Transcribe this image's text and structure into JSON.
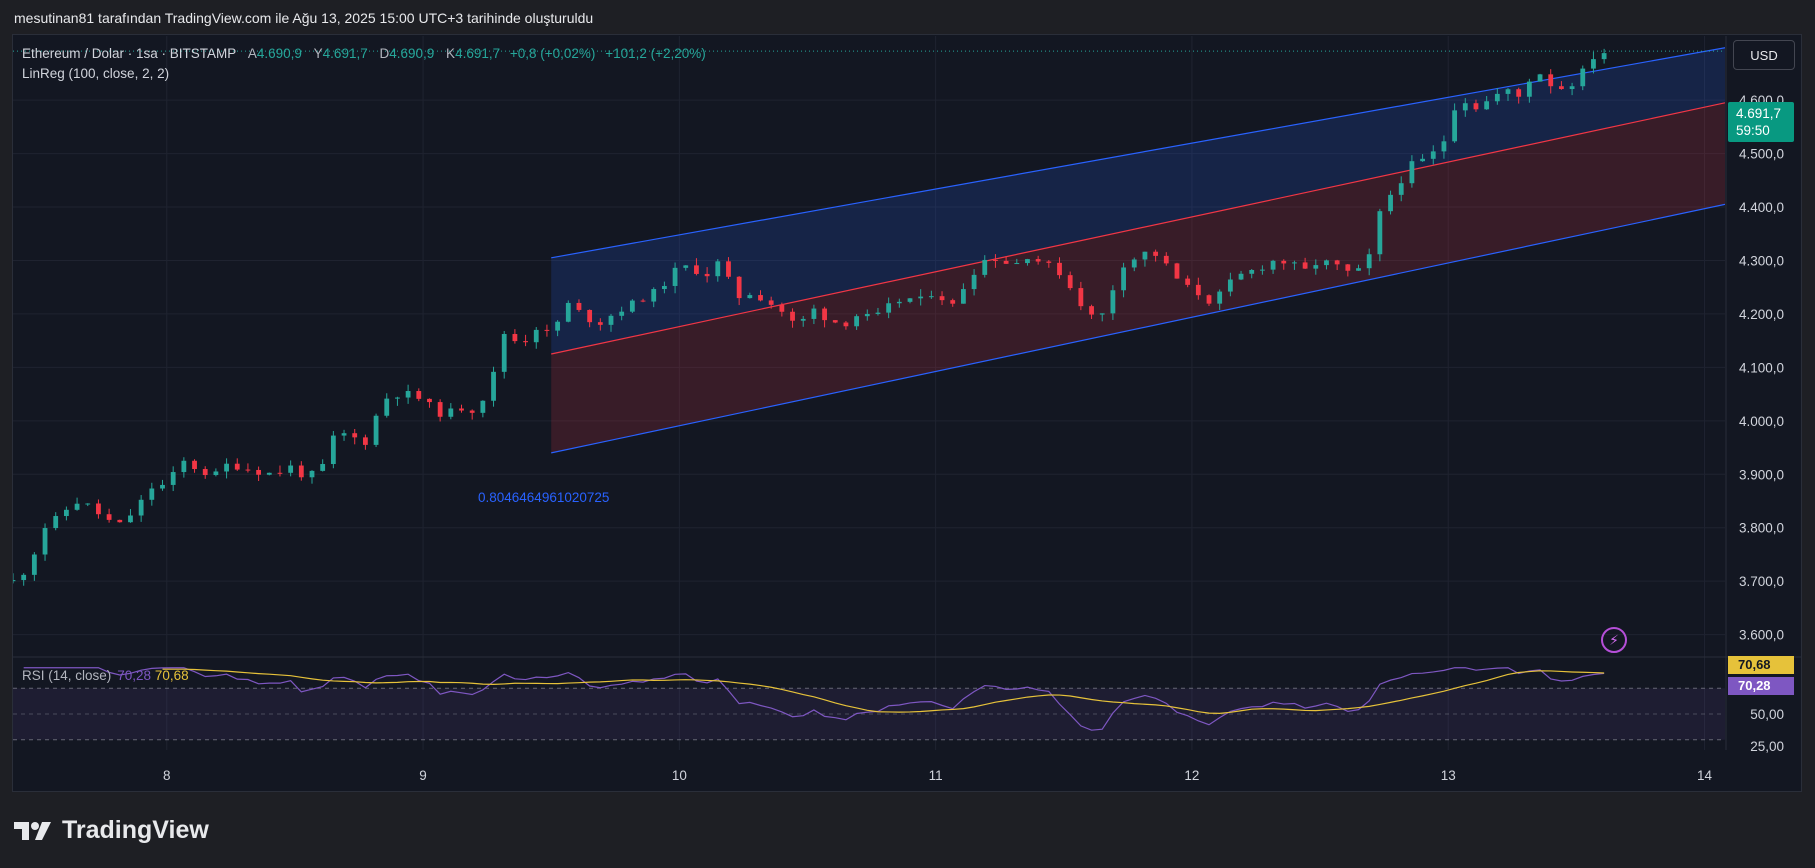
{
  "caption": "mesutinan81 tarafından TradingView.com ile Ağu 13, 2025 15:00 UTC+3 tarihinde oluşturuldu",
  "legend": {
    "symbol": "Ethereum / Dolar · 1sa · BITSTAMP",
    "o_label": "A",
    "o": "4.690,9",
    "h_label": "Y",
    "h": "4.691,7",
    "l_label": "D",
    "l": "4.690,9",
    "c_label": "K",
    "c": "4.691,7",
    "change": "+0,8 (+0,02%)",
    "change2": "+101,2 (+2,20%)",
    "indicator": "LinReg (100, close, 2, 2)"
  },
  "currency_button": "USD",
  "price_badge": {
    "price": "4.691,7",
    "countdown": "59:50"
  },
  "linreg_label": "0.8046464961020725",
  "rsi": {
    "label": "RSI (14, close)",
    "rsi": "70,28",
    "ma": "70,68"
  },
  "brand": "TradingView",
  "colors": {
    "up": "#26a69a",
    "down": "#f23645",
    "rsi": "#7e57c2",
    "rsi_ma": "#e6c23a",
    "channel_blue": "#2962ff",
    "channel_red": "#f23645"
  },
  "chart_data": {
    "type": "candlestick",
    "price_axis": {
      "min": 3560,
      "max": 4720,
      "ticks": [
        "3.600,0",
        "3.700,0",
        "3.800,0",
        "3.900,0",
        "4.000,0",
        "4.100,0",
        "4.200,0",
        "4.300,0",
        "4.400,0",
        "4.500,0",
        "4.600,0"
      ]
    },
    "x_ticks": [
      "8",
      "9",
      "10",
      "11",
      "12",
      "13",
      "14"
    ],
    "x_range": [
      7.4,
      14.08
    ],
    "close_series": [
      [
        7.4,
        3700
      ],
      [
        7.46,
        3725
      ],
      [
        7.52,
        3800
      ],
      [
        7.58,
        3820
      ],
      [
        7.64,
        3850
      ],
      [
        7.7,
        3840
      ],
      [
        7.76,
        3815
      ],
      [
        7.82,
        3805
      ],
      [
        7.88,
        3835
      ],
      [
        7.94,
        3875
      ],
      [
        8.0,
        3880
      ],
      [
        8.06,
        3925
      ],
      [
        8.12,
        3910
      ],
      [
        8.18,
        3895
      ],
      [
        8.24,
        3920
      ],
      [
        8.3,
        3912
      ],
      [
        8.36,
        3905
      ],
      [
        8.42,
        3900
      ],
      [
        8.48,
        3915
      ],
      [
        8.54,
        3895
      ],
      [
        8.6,
        3905
      ],
      [
        8.66,
        3980
      ],
      [
        8.72,
        3970
      ],
      [
        8.78,
        3960
      ],
      [
        8.84,
        4040
      ],
      [
        8.9,
        4050
      ],
      [
        8.96,
        4050
      ],
      [
        9.02,
        4030
      ],
      [
        9.08,
        4010
      ],
      [
        9.14,
        4025
      ],
      [
        9.2,
        4020
      ],
      [
        9.26,
        4060
      ],
      [
        9.32,
        4170
      ],
      [
        9.38,
        4140
      ],
      [
        9.44,
        4175
      ],
      [
        9.5,
        4160
      ],
      [
        9.56,
        4220
      ],
      [
        9.62,
        4200
      ],
      [
        9.68,
        4180
      ],
      [
        9.74,
        4200
      ],
      [
        9.8,
        4215
      ],
      [
        9.86,
        4230
      ],
      [
        9.92,
        4245
      ],
      [
        9.98,
        4280
      ],
      [
        10.04,
        4290
      ],
      [
        10.1,
        4270
      ],
      [
        10.16,
        4300
      ],
      [
        10.22,
        4230
      ],
      [
        10.28,
        4240
      ],
      [
        10.34,
        4225
      ],
      [
        10.4,
        4205
      ],
      [
        10.46,
        4175
      ],
      [
        10.52,
        4210
      ],
      [
        10.58,
        4190
      ],
      [
        10.64,
        4180
      ],
      [
        10.7,
        4200
      ],
      [
        10.76,
        4190
      ],
      [
        10.82,
        4215
      ],
      [
        10.88,
        4230
      ],
      [
        10.94,
        4225
      ],
      [
        11.0,
        4245
      ],
      [
        11.06,
        4210
      ],
      [
        11.12,
        4260
      ],
      [
        11.18,
        4300
      ],
      [
        11.24,
        4305
      ],
      [
        11.3,
        4290
      ],
      [
        11.36,
        4310
      ],
      [
        11.42,
        4295
      ],
      [
        11.48,
        4280
      ],
      [
        11.54,
        4240
      ],
      [
        11.6,
        4195
      ],
      [
        11.66,
        4200
      ],
      [
        11.72,
        4290
      ],
      [
        11.78,
        4305
      ],
      [
        11.84,
        4320
      ],
      [
        11.9,
        4290
      ],
      [
        11.96,
        4255
      ],
      [
        12.02,
        4240
      ],
      [
        12.08,
        4220
      ],
      [
        12.14,
        4255
      ],
      [
        12.2,
        4275
      ],
      [
        12.26,
        4285
      ],
      [
        12.32,
        4300
      ],
      [
        12.38,
        4295
      ],
      [
        12.44,
        4280
      ],
      [
        12.5,
        4300
      ],
      [
        12.56,
        4290
      ],
      [
        12.62,
        4275
      ],
      [
        12.68,
        4285
      ],
      [
        12.74,
        4400
      ],
      [
        12.8,
        4440
      ],
      [
        12.86,
        4480
      ],
      [
        12.92,
        4490
      ],
      [
        12.98,
        4520
      ],
      [
        13.04,
        4610
      ],
      [
        13.1,
        4585
      ],
      [
        13.16,
        4600
      ],
      [
        13.22,
        4620
      ],
      [
        13.28,
        4605
      ],
      [
        13.34,
        4660
      ],
      [
        13.4,
        4630
      ],
      [
        13.46,
        4620
      ],
      [
        13.52,
        4650
      ],
      [
        13.58,
        4690
      ]
    ],
    "linreg_channel": {
      "x_start": 9.5,
      "x_end": 14.08,
      "upper": [
        4305,
        4698
      ],
      "middle": [
        4125,
        4595
      ],
      "lower": [
        3940,
        4405
      ]
    },
    "rsi_panel": {
      "min": 22,
      "max": 92,
      "ticks": [
        "50,00",
        "25,00"
      ],
      "levels": [
        70,
        50,
        30
      ]
    }
  }
}
